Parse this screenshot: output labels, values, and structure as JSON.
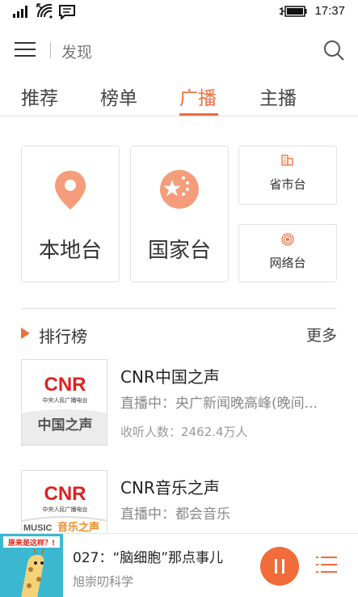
{
  "status": {
    "time": "17:37"
  },
  "header": {
    "title": "发现"
  },
  "tabs": [
    {
      "label": "推荐"
    },
    {
      "label": "榜单"
    },
    {
      "label": "广播",
      "active": true
    },
    {
      "label": "主播"
    }
  ],
  "categories": {
    "local": "本地台",
    "national": "国家台",
    "provincial": "省市台",
    "network": "网络台"
  },
  "ranking": {
    "title": "排行榜",
    "more": "更多"
  },
  "stations": [
    {
      "name": "CNR中国之声",
      "live": "直播中：央广新闻晚高峰(晚间...",
      "listeners": "收听人数：2462.4万人",
      "logo_brand": "CNR",
      "logo_sub": "中央人民广播电台",
      "logo_channel": "中国之声"
    },
    {
      "name": "CNR音乐之声",
      "live": "直播中：都会音乐",
      "logo_brand": "CNR",
      "logo_sub": "中央人民广播电台",
      "logo_channel": "音乐之声",
      "logo_prefix": "MUSIC"
    }
  ],
  "player": {
    "title": "027：“脑细胞”那点事儿",
    "artist": "旭崇叨科学",
    "album_text": "原来是这样？!"
  },
  "colors": {
    "accent": "#f26b3a",
    "icon_bg": "#f59c7a"
  }
}
